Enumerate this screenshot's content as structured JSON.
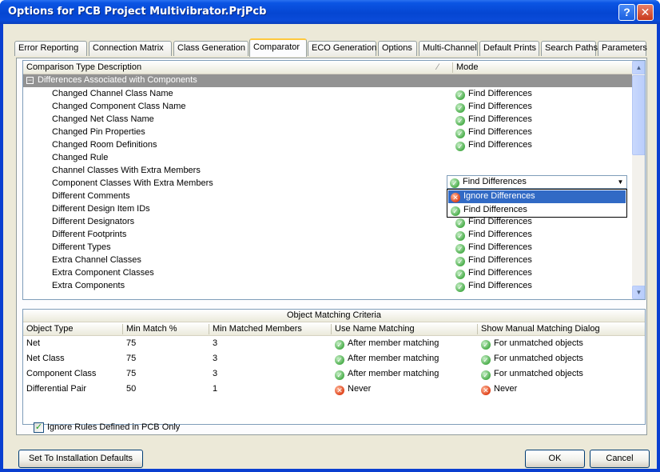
{
  "title": "Options for PCB Project Multivibrator.PrjPcb",
  "titlebar_buttons": {
    "help": "?",
    "close": "✕"
  },
  "tabs": [
    {
      "label": "Error Reporting"
    },
    {
      "label": "Connection Matrix"
    },
    {
      "label": "Class Generation"
    },
    {
      "label": "Comparator",
      "active": true
    },
    {
      "label": "ECO Generation"
    },
    {
      "label": "Options"
    },
    {
      "label": "Multi-Channel"
    },
    {
      "label": "Default Prints"
    },
    {
      "label": "Search Paths"
    },
    {
      "label": "Parameters"
    }
  ],
  "comparison": {
    "header_desc": "Comparison Type Description",
    "header_mode": "Mode",
    "group": "Differences Associated with Components",
    "rows": [
      {
        "name": "Changed Channel Class Name",
        "mode": "Find Differences"
      },
      {
        "name": "Changed Component Class Name",
        "mode": "Find Differences"
      },
      {
        "name": "Changed Net Class Name",
        "mode": "Find Differences"
      },
      {
        "name": "Changed Pin Properties",
        "mode": "Find Differences"
      },
      {
        "name": "Changed Room Definitions",
        "mode": "Find Differences"
      },
      {
        "name": "Changed Rule",
        "mode": ""
      },
      {
        "name": "Channel Classes With Extra Members",
        "mode": ""
      },
      {
        "name": "Component Classes With Extra Members",
        "mode": "Find Differences"
      },
      {
        "name": "Different Comments",
        "mode": "Find Differences"
      },
      {
        "name": "Different Design Item IDs",
        "mode": "Find Differences"
      },
      {
        "name": "Different Designators",
        "mode": "Find Differences"
      },
      {
        "name": "Different Footprints",
        "mode": "Find Differences"
      },
      {
        "name": "Different Types",
        "mode": "Find Differences"
      },
      {
        "name": "Extra Channel Classes",
        "mode": "Find Differences"
      },
      {
        "name": "Extra Component Classes",
        "mode": "Find Differences"
      },
      {
        "name": "Extra Components",
        "mode": "Find Differences"
      }
    ],
    "dropdown": {
      "value": "Find Differences",
      "options": [
        {
          "label": "Ignore Differences",
          "selected": true
        },
        {
          "label": "Find Differences"
        }
      ]
    }
  },
  "criteria": {
    "title": "Object Matching Criteria",
    "columns": [
      "Object Type",
      "Min Match %",
      "Min Matched Members",
      "Use Name Matching",
      "Show Manual Matching Dialog"
    ],
    "rows": [
      {
        "type": "Net",
        "min_match": "75",
        "min_members": "3",
        "name_matching": "After member matching",
        "name_ok": true,
        "dialog": "For unmatched objects",
        "dialog_ok": true
      },
      {
        "type": "Net Class",
        "min_match": "75",
        "min_members": "3",
        "name_matching": "After member matching",
        "name_ok": true,
        "dialog": "For unmatched objects",
        "dialog_ok": true
      },
      {
        "type": "Component Class",
        "min_match": "75",
        "min_members": "3",
        "name_matching": "After member matching",
        "name_ok": true,
        "dialog": "For unmatched objects",
        "dialog_ok": true
      },
      {
        "type": "Differential Pair",
        "min_match": "50",
        "min_members": "1",
        "name_matching": "Never",
        "name_ok": false,
        "dialog": "Never",
        "dialog_ok": false
      }
    ]
  },
  "ignore_rules": {
    "label": "Ignore Rules Defined in PCB Only",
    "checked": true
  },
  "buttons": {
    "defaults": "Set To Installation Defaults",
    "ok": "OK",
    "cancel": "Cancel"
  },
  "colors": {
    "group_bg": "#939393",
    "selection": "#316ac5",
    "tab_active_accent": "#ffc83c",
    "title_bar": "#0546d2"
  }
}
